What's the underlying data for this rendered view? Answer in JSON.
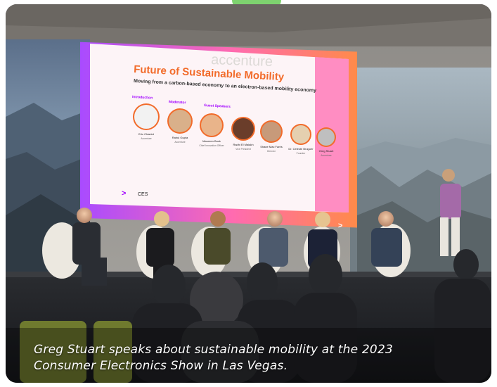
{
  "photo": {
    "brand_sign": "accenture",
    "screen": {
      "title_part1": "Future of ",
      "title_part2": "Sustainable Mobility",
      "subtitle": "Moving from a carbon-based economy to an electron-based mobility economy",
      "section_intro": "Introduction",
      "section_moderator": "Moderator",
      "section_guests": "Guest Speakers",
      "speakers": [
        {
          "name": "Eric Chaniot",
          "role": "Accenture"
        },
        {
          "name": "Rahul Gupta",
          "role": "Accenture"
        },
        {
          "name": "Maureen Buck",
          "role": "Chief Innovation Officer"
        },
        {
          "name": "Radhi El Malakh",
          "role": "Vice President"
        },
        {
          "name": "Shane Mac Farris",
          "role": "Director"
        },
        {
          "name": "Dr. Celeste Bruguer",
          "role": "Founder"
        },
        {
          "name": "Greg Stuart",
          "role": "Accenture"
        }
      ],
      "footer_logo": "CES",
      "arrow": ">"
    }
  },
  "caption": {
    "line1": "Greg Stuart speaks about sustainable mobility at the 2023",
    "line2": "Consumer Electronics Show in Las Vegas."
  },
  "colors": {
    "brand_purple": "#a100ff",
    "title_orange": "#f26b2a",
    "green_tab": "#7ed36f"
  }
}
